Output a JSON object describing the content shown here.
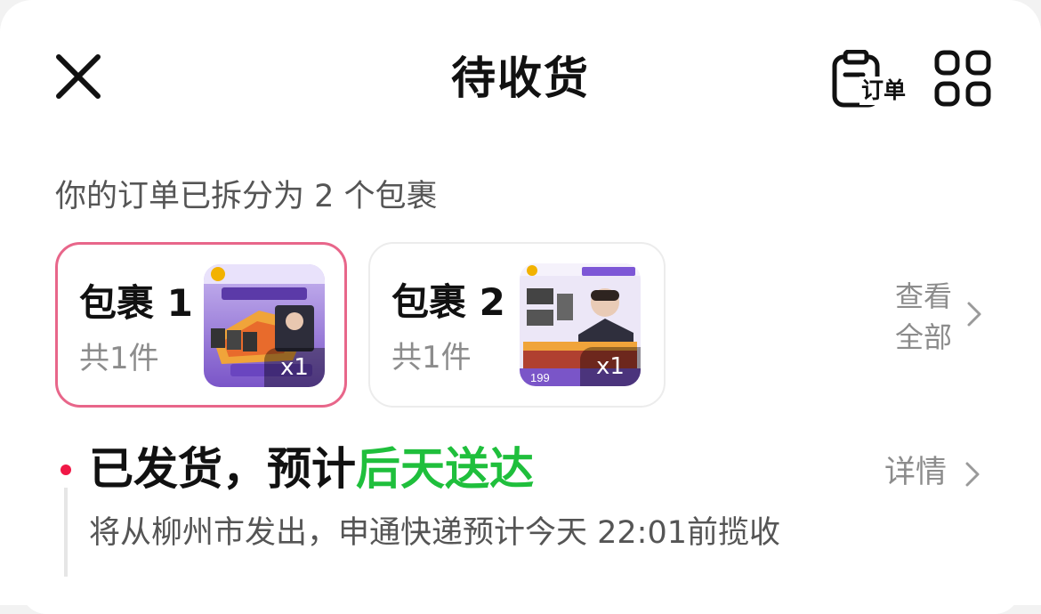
{
  "header": {
    "title": "待收货",
    "close_icon": "close-icon",
    "order_label": "订单",
    "order_icon": "clipboard-icon",
    "grid_icon": "grid-icon"
  },
  "split_notice": "你的订单已拆分为 2 个包裹",
  "packages": [
    {
      "name": "包裹 1",
      "count": "共1件",
      "qty": "x1",
      "selected": true
    },
    {
      "name": "包裹 2",
      "count": "共1件",
      "qty": "x1",
      "selected": false
    }
  ],
  "view_all": {
    "line1": "查看",
    "line2": "全部"
  },
  "shipment": {
    "status_prefix": "已发货，预计",
    "status_highlight": "后天送达",
    "details_label": "详情",
    "info": "将从柳州市发出，申通快递预计今天 22:01前揽收"
  },
  "colors": {
    "accent_border": "#e8668a",
    "highlight_green": "#1fbf3c",
    "status_dot": "#f01846"
  }
}
